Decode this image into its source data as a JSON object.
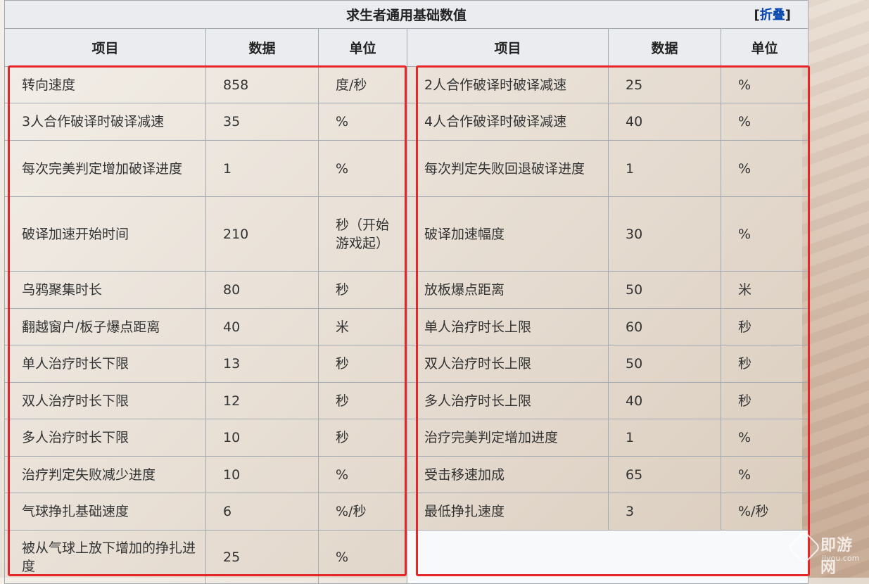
{
  "table": {
    "title": "求生者通用基础数值",
    "fold": {
      "open": "[",
      "link": "折叠",
      "close": "]"
    },
    "headers": [
      "项目",
      "数据",
      "单位",
      "项目",
      "数据",
      "单位"
    ],
    "rows": [
      {
        "k1": "转向速度",
        "v1": "858",
        "u1": "度/秒",
        "k2": "2人合作破译时破译减速",
        "v2": "25",
        "u2": "%"
      },
      {
        "k1": "3人合作破译时破译减速",
        "v1": "35",
        "u1": "%",
        "k2": "4人合作破译时破译减速",
        "v2": "40",
        "u2": "%"
      },
      {
        "k1": "每次完美判定增加破译进度",
        "v1": "1",
        "u1": "%",
        "k2": "每次判定失败回退破译进度",
        "v2": "1",
        "u2": "%"
      },
      {
        "k1": "破译加速开始时间",
        "v1": "210",
        "u1": "秒（开始游戏起）",
        "k2": "破译加速幅度",
        "v2": "30",
        "u2": "%"
      },
      {
        "k1": "乌鸦聚集时长",
        "v1": "80",
        "u1": "秒",
        "k2": "放板爆点距离",
        "v2": "50",
        "u2": "米"
      },
      {
        "k1": "翻越窗户/板子爆点距离",
        "v1": "40",
        "u1": "米",
        "k2": "单人治疗时长上限",
        "v2": "60",
        "u2": "秒"
      },
      {
        "k1": "单人治疗时长下限",
        "v1": "13",
        "u1": "秒",
        "k2": "双人治疗时长上限",
        "v2": "50",
        "u2": "秒"
      },
      {
        "k1": "双人治疗时长下限",
        "v1": "12",
        "u1": "秒",
        "k2": "多人治疗时长上限",
        "v2": "40",
        "u2": "秒"
      },
      {
        "k1": "多人治疗时长下限",
        "v1": "10",
        "u1": "秒",
        "k2": "治疗完美判定增加进度",
        "v2": "1",
        "u2": "%"
      },
      {
        "k1": "治疗判定失败减少进度",
        "v1": "10",
        "u1": "%",
        "k2": "受击移速加成",
        "v2": "65",
        "u2": "%"
      },
      {
        "k1": "气球挣扎基础速度",
        "v1": "6",
        "u1": "%/秒",
        "k2": "最低挣扎速度",
        "v2": "3",
        "u2": "%/秒"
      },
      {
        "k1": "被从气球上放下增加的挣扎进度",
        "v1": "25",
        "u1": "%",
        "k2": "",
        "v2": "",
        "u2": ""
      }
    ]
  },
  "watermark": {
    "text": "即游网",
    "sub": "jiyou.com"
  },
  "colors": {
    "highlight": "#e5262b",
    "header_bg": "#eaecf0",
    "border": "#a2a9b1",
    "link": "#0645ad"
  }
}
